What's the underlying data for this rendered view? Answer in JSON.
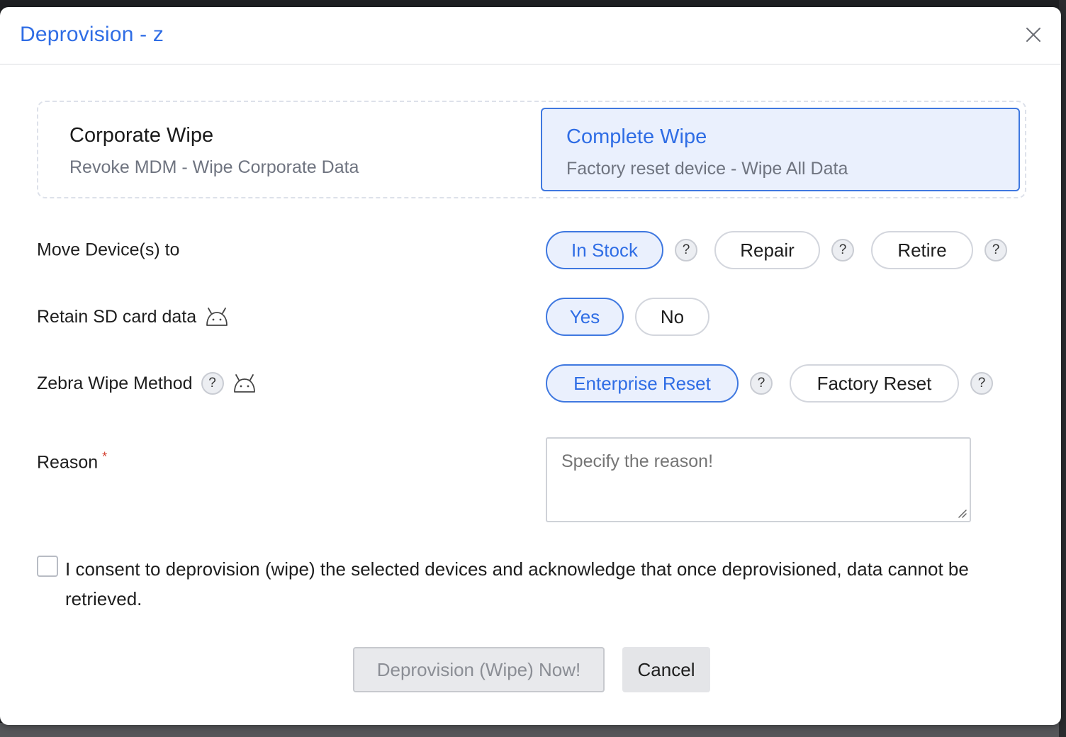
{
  "dialog": {
    "title": "Deprovision - z",
    "close_icon": "close-icon"
  },
  "wipe_options": [
    {
      "title": "Corporate Wipe",
      "subtitle": "Revoke MDM - Wipe Corporate Data",
      "selected": false
    },
    {
      "title": "Complete Wipe",
      "subtitle": "Factory reset device - Wipe All Data",
      "selected": true
    }
  ],
  "move_device": {
    "label": "Move Device(s) to",
    "options": [
      "In Stock",
      "Repair",
      "Retire"
    ],
    "selected": "In Stock",
    "help": "?"
  },
  "retain_sd": {
    "label": "Retain SD card data",
    "icon": "android-icon",
    "options": [
      "Yes",
      "No"
    ],
    "selected": "Yes"
  },
  "zebra_wipe": {
    "label": "Zebra Wipe Method",
    "help": "?",
    "icon": "android-icon",
    "options": [
      "Enterprise Reset",
      "Factory Reset"
    ],
    "selected": "Enterprise Reset"
  },
  "reason": {
    "label": "Reason",
    "required_mark": "*",
    "placeholder": "Specify the reason!",
    "value": ""
  },
  "consent": {
    "checked": false,
    "text": "I consent to deprovision (wipe) the selected devices and acknowledge that once deprovisioned, data cannot be retrieved."
  },
  "footer": {
    "primary_label": "Deprovision (Wipe) Now!",
    "primary_disabled": true,
    "cancel_label": "Cancel"
  },
  "colors": {
    "accent": "#2f6de5",
    "selected_bg": "#eaf0fd",
    "required": "#d23b2b"
  }
}
